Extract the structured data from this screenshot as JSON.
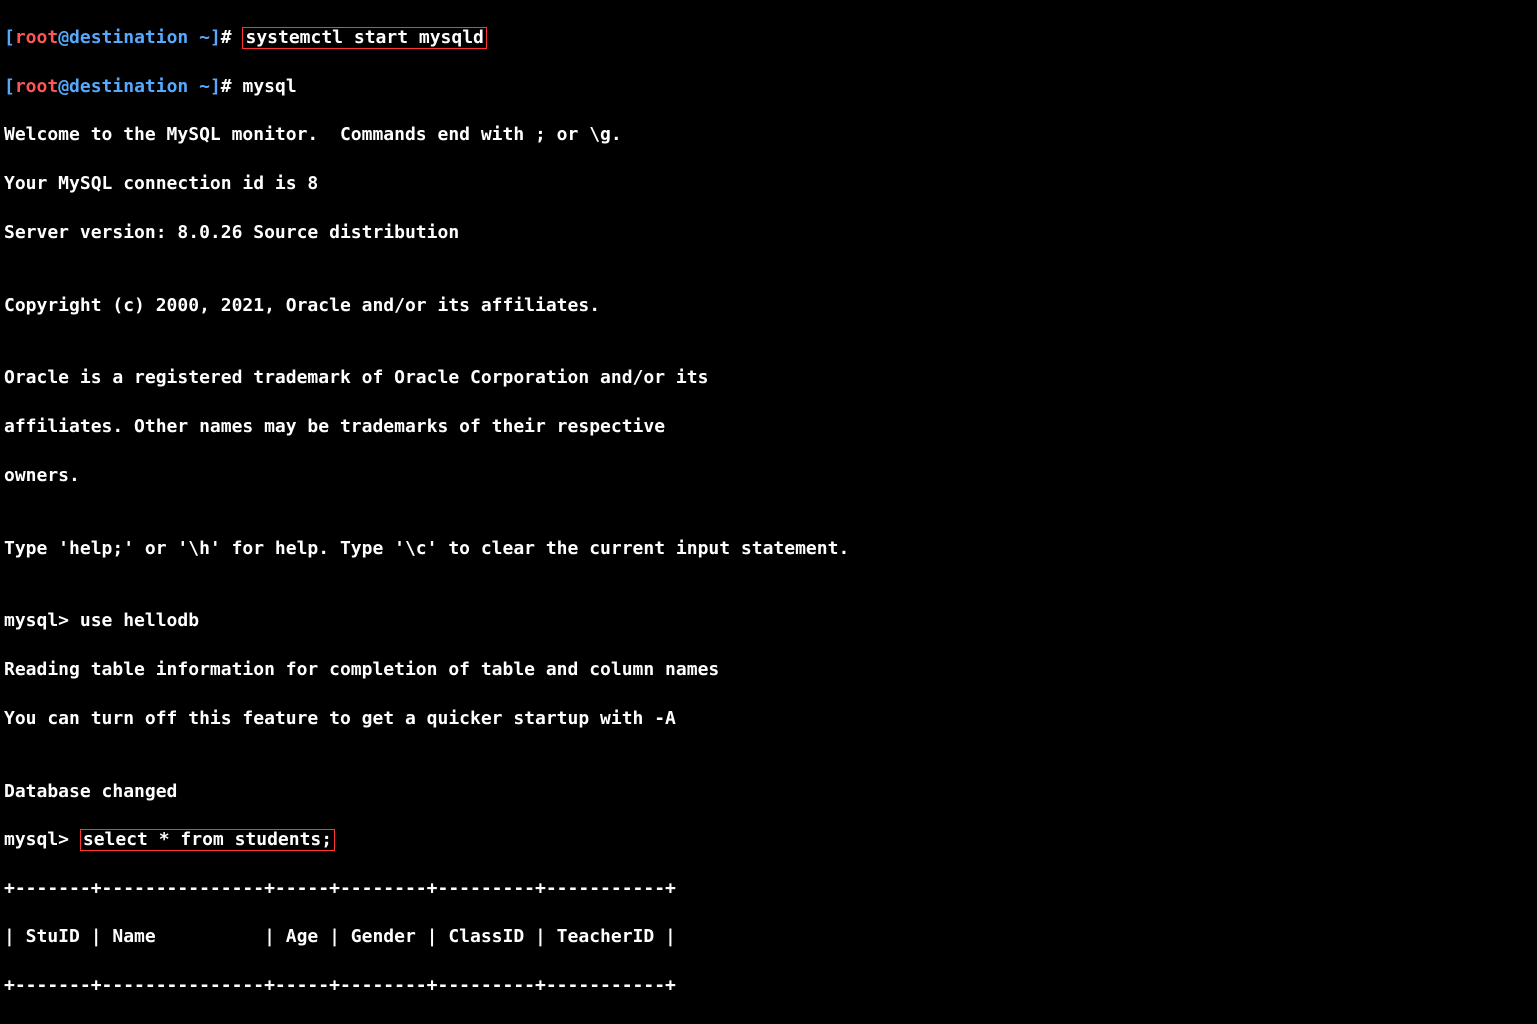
{
  "prompt": {
    "open": "[",
    "user": "root",
    "at": "@",
    "host": "destination",
    "space": " ",
    "tilde": "~",
    "close": "]",
    "hash": "#"
  },
  "cmd1": "systemctl start mysqld",
  "cmd2": "mysql",
  "welcome": [
    "Welcome to the MySQL monitor.  Commands end with ; or \\g.",
    "Your MySQL connection id is 8",
    "Server version: 8.0.26 Source distribution",
    "",
    "Copyright (c) 2000, 2021, Oracle and/or its affiliates.",
    "",
    "Oracle is a registered trademark of Oracle Corporation and/or its",
    "affiliates. Other names may be trademarks of their respective",
    "owners.",
    "",
    "Type 'help;' or '\\h' for help. Type '\\c' to clear the current input statement.",
    ""
  ],
  "mysql_prompt": "mysql> ",
  "use_cmd": "use hellodb",
  "use_out": [
    "Reading table information for completion of table and column names",
    "You can turn off this feature to get a quicker startup with -A",
    "",
    "Database changed"
  ],
  "select_cmd": "select * from students;",
  "table_border": "+-------+---------------+-----+--------+---------+-----------+",
  "table_header": "| StuID | Name          | Age | Gender | ClassID | TeacherID |"
}
